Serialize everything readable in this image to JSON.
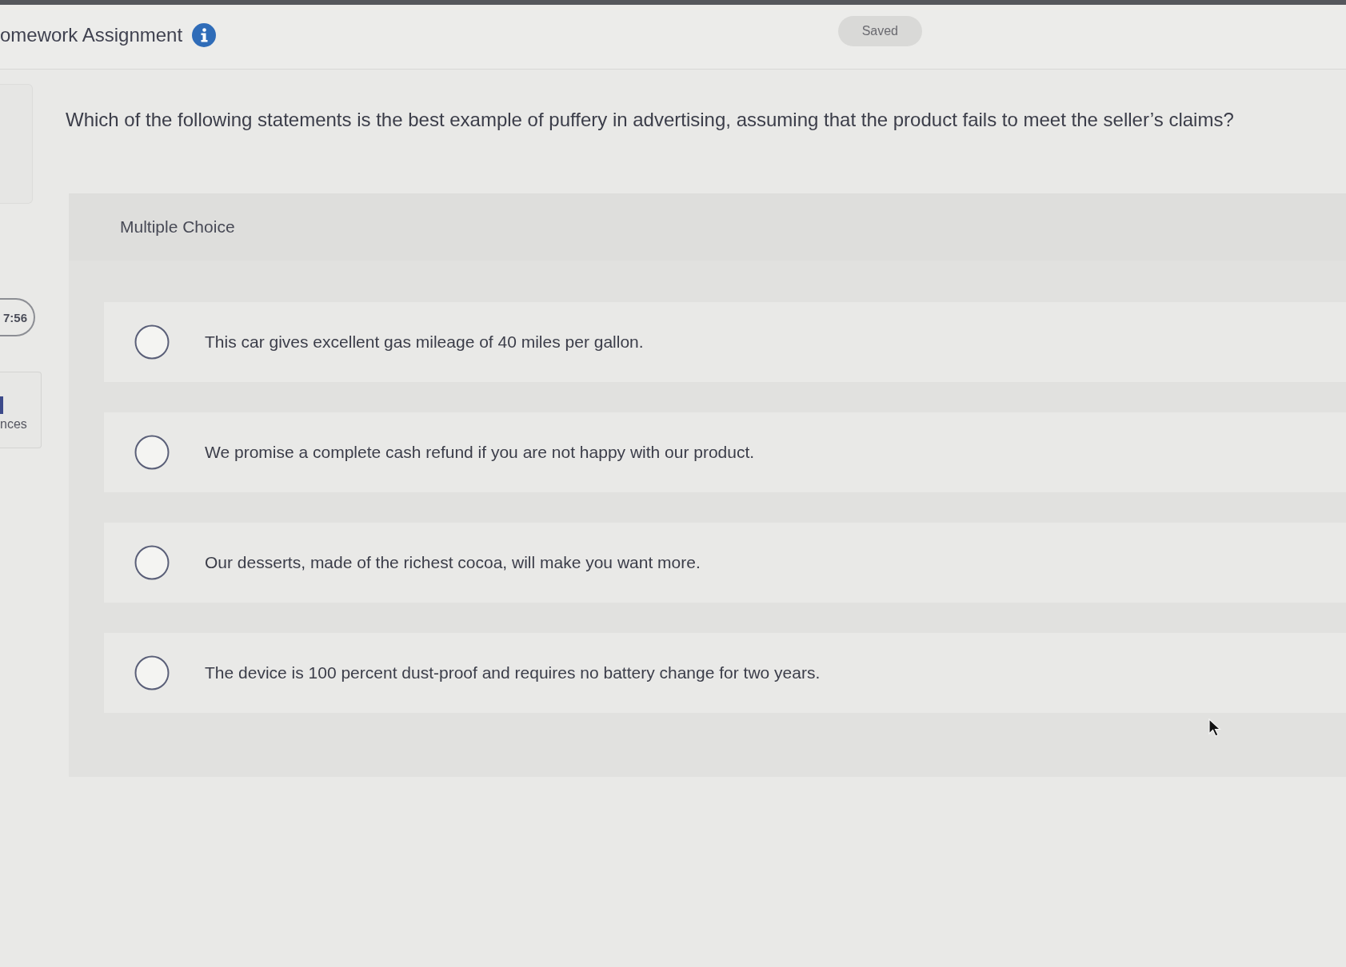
{
  "header": {
    "title": "omework Assignment",
    "status": "Saved"
  },
  "sidebar": {
    "timer": "7:56",
    "card_label": "nces"
  },
  "question": {
    "prompt": "Which of the following statements is the best example of puffery in advertising, assuming that the product fails to meet the seller’s claims?",
    "type_label": "Multiple Choice",
    "options": [
      {
        "text": "This car gives excellent gas mileage of 40 miles per gallon.",
        "selected": false
      },
      {
        "text": "We promise a complete cash refund if you are not happy with our product.",
        "selected": false
      },
      {
        "text": "Our desserts, made of the richest cocoa, will make you want more.",
        "selected": false
      },
      {
        "text": "The device is 100 percent dust-proof and requires no battery change for two years.",
        "selected": false
      }
    ]
  }
}
